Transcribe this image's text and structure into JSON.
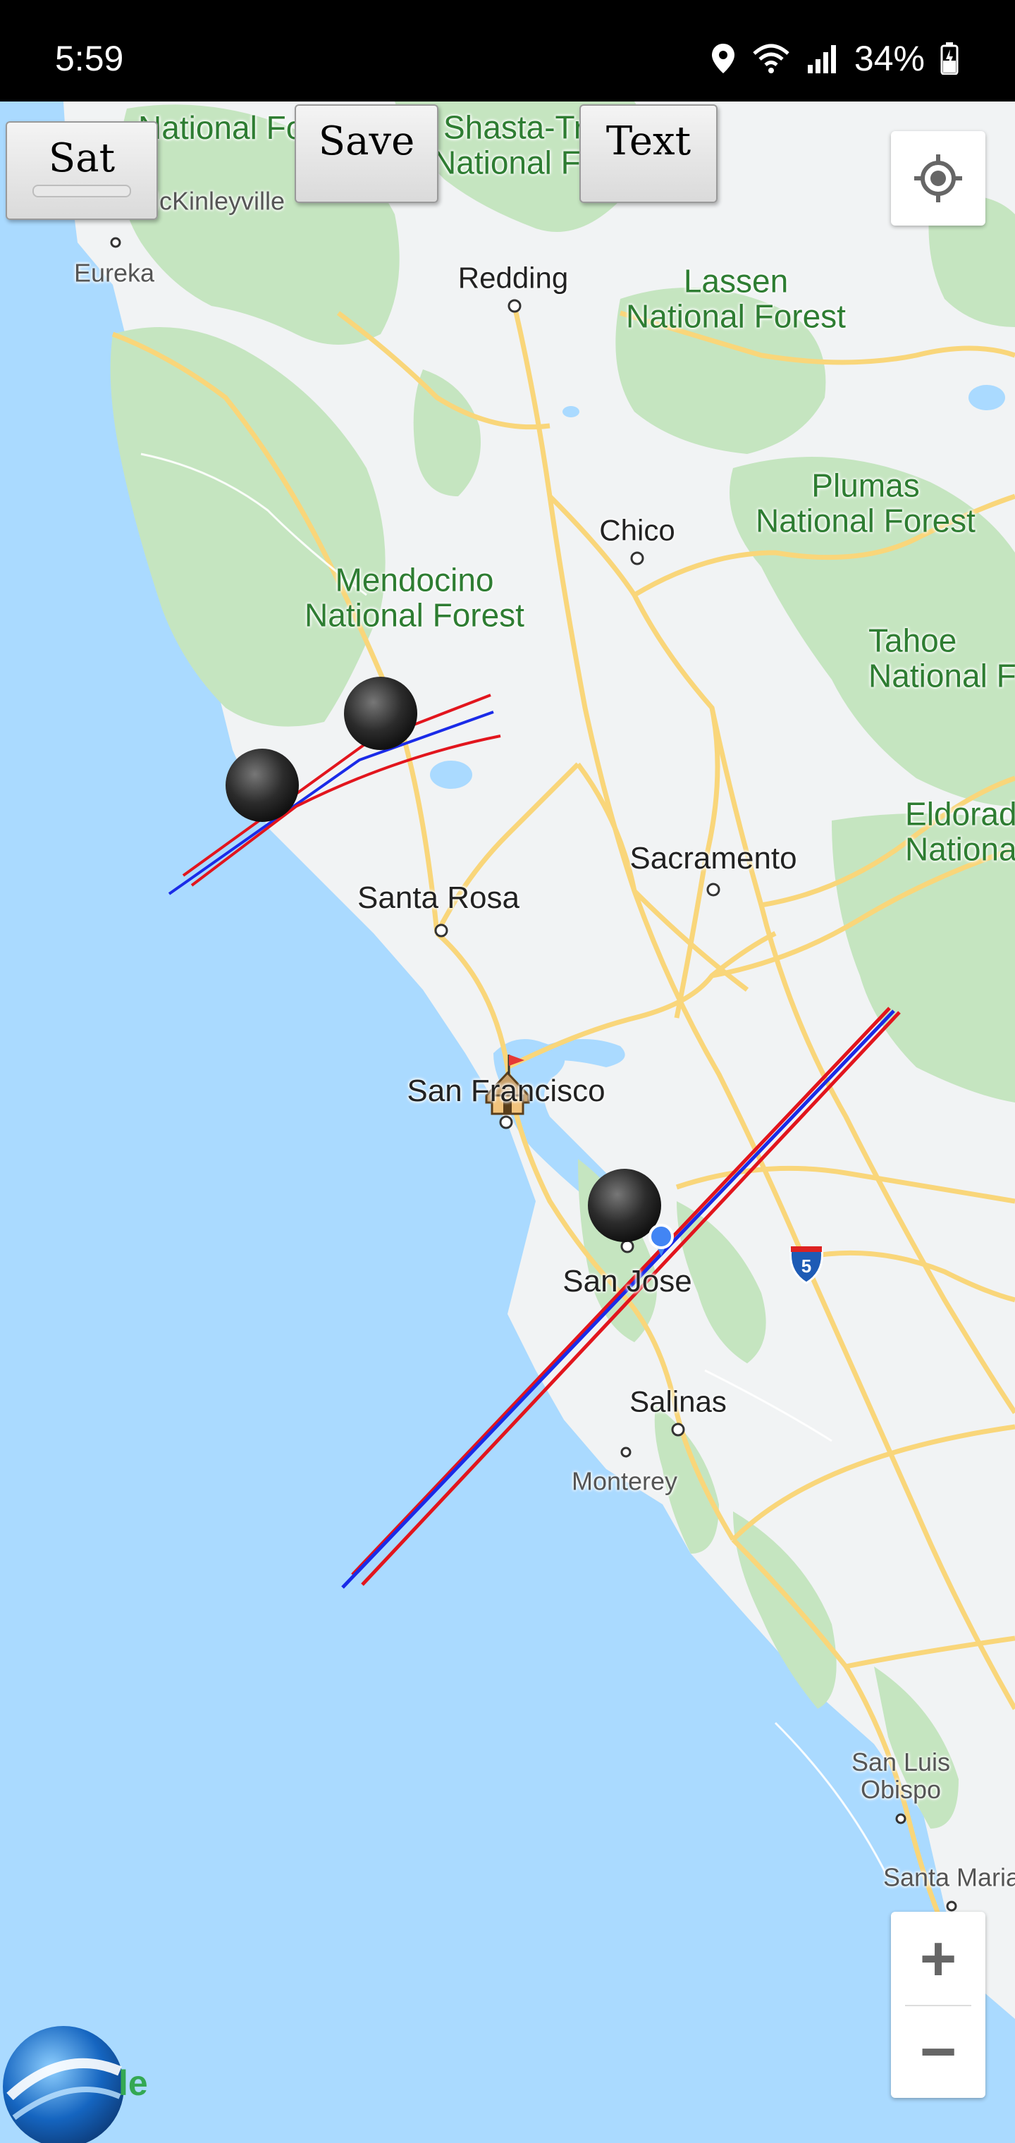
{
  "status_bar": {
    "time": "5:59",
    "battery": "34%",
    "icons": [
      "location-icon",
      "wifi-icon",
      "signal-icon",
      "battery-icon"
    ]
  },
  "toolbar": {
    "sat_label": "Sat",
    "save_label": "Save",
    "text_label": "Text"
  },
  "map": {
    "forests": [
      "National Forest",
      "Shasta-Trinity\nNational Forest",
      "Lassen\nNational Forest",
      "Plumas\nNational Forest",
      "Mendocino\nNational Forest",
      "Tahoe\nNational Forest",
      "Eldorado\nNational Forest"
    ],
    "cities": [
      "Redding",
      "Chico",
      "Sacramento",
      "Santa Rosa",
      "San Francisco",
      "San Jose",
      "Salinas"
    ],
    "towns": [
      "McKinleyville",
      "Eureka",
      "Monterey",
      "San Luis\nObispo",
      "Santa Maria"
    ],
    "highway_shield": "5",
    "markers": [
      "moon-marker",
      "moon-marker",
      "moon-marker",
      "home-marker",
      "current-location-dot"
    ]
  },
  "controls": {
    "my_location_icon": "my-location-icon",
    "zoom_in": "+",
    "zoom_out": "−"
  },
  "logo": {
    "letters": "le"
  },
  "colors": {
    "water": "#aadaff",
    "land": "#f1f3f4",
    "forest": "#c5e5c0",
    "road": "#f9d67a",
    "track_red": "#e2151d",
    "track_blue": "#1a2be8",
    "forest_text": "#2e7d32"
  }
}
